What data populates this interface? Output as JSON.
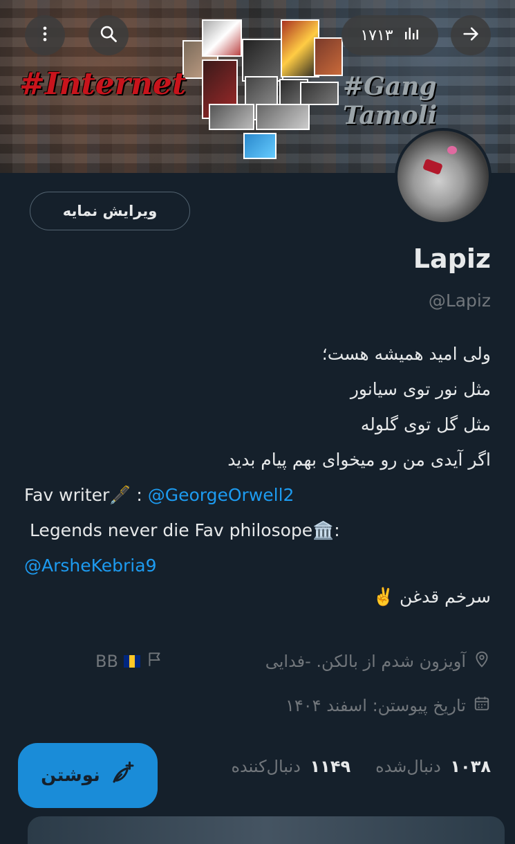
{
  "banner": {
    "left_tag": "#Internet",
    "right_tag": "#Gang Tamoli"
  },
  "topbar": {
    "more_icon": "more-vertical-icon",
    "search_icon": "search-icon",
    "views_count": "۱۷۱۳",
    "views_icon": "analytics-bars-icon",
    "forward_icon": "arrow-right-icon"
  },
  "profile": {
    "edit_label": "ویرایش نمایه",
    "display_name": "Lapiz",
    "handle": "@Lapiz"
  },
  "bio": {
    "line1": "ولی امید همیشه هست؛",
    "line2": "مثل نور توی سیانور",
    "line3": "مثل گل توی گلوله",
    "line4": "اگر آیدی من رو میخوای بهم پیام بدید",
    "fav_writer_label": "Fav writer🖋️ : ",
    "fav_writer_link": "@GeorgeOrwell2",
    "philosopher_label": " Legends never die Fav philosope🏛️:",
    "philosopher_link": "@ArsheKebria9",
    "motto": "سرخم قدغن ✌️"
  },
  "meta": {
    "location": "آویزون شدم از بالکن. -فدایی",
    "extra": "BB",
    "join_date": "تاریخ پیوستن: اسفند ۱۴۰۴"
  },
  "stats": {
    "following_count": "۱۰۳۸",
    "following_label": "دنبال‌شده",
    "followers_count": "۱۱۴۹",
    "followers_label": "دنبال‌کننده"
  },
  "compose": {
    "label": "نوشتن",
    "icon": "feather-plus-icon"
  },
  "colors": {
    "background": "#15202b",
    "link": "#1d9bf0",
    "accent": "#1a8cd8",
    "muted": "#71767b"
  }
}
